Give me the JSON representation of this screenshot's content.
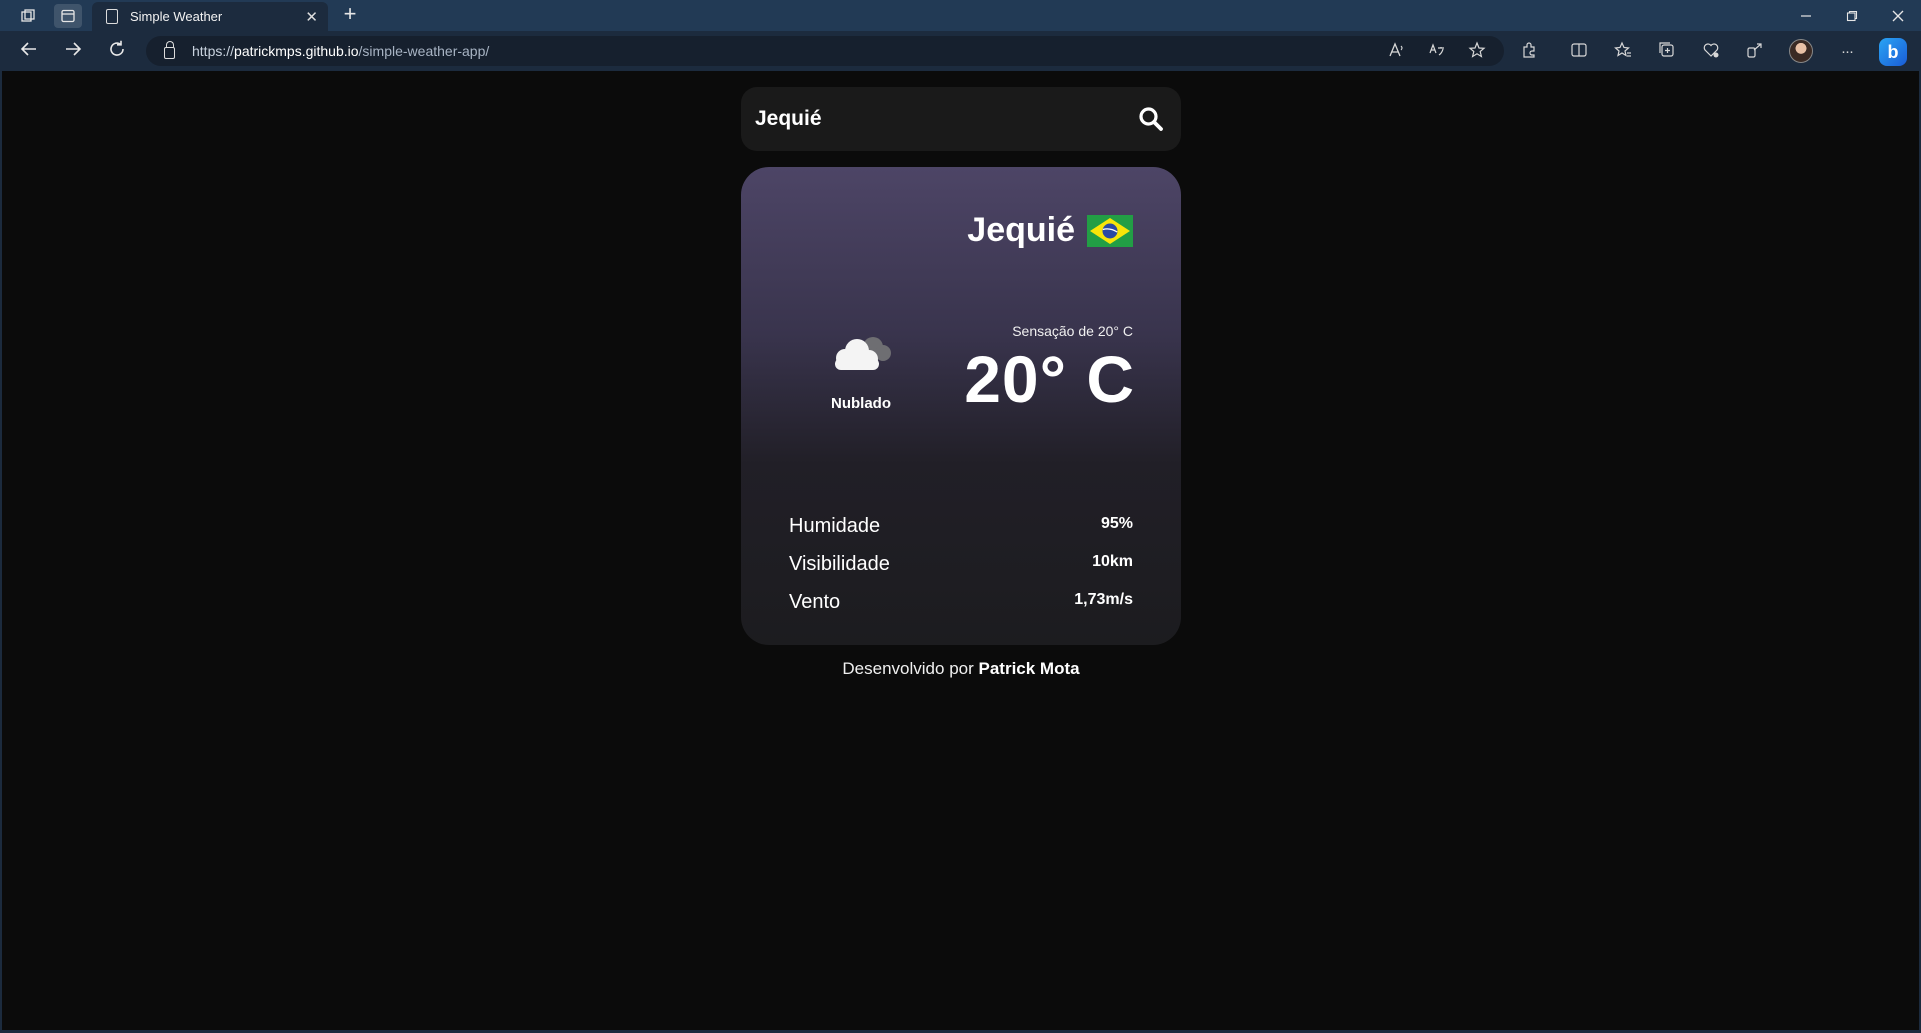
{
  "browser": {
    "tab_title": "Simple Weather",
    "url_scheme": "https://",
    "url_host": "patrickmps.github.io",
    "url_path": "/simple-weather-app/",
    "new_tab_glyph": "+",
    "close_tab_glyph": "✕",
    "more_glyph": "···"
  },
  "search": {
    "value": "Jequié",
    "icon": "search-icon"
  },
  "weather": {
    "city": "Jequié",
    "country_flag": "brazil-flag",
    "condition_icon": "cloud-icon",
    "condition": "Nublado",
    "feels_like": "Sensação de 20° C",
    "temperature": "20° C"
  },
  "stats": [
    {
      "label": "Humidade",
      "value": "95%"
    },
    {
      "label": "Visibilidade",
      "value": "10km"
    },
    {
      "label": "Vento",
      "value": "1,73m/s"
    }
  ],
  "footer": {
    "prefix": "Desenvolvido por",
    "author": "Patrick Mota"
  },
  "colors": {
    "page_bg": "#0b0b0b",
    "card_top": "#4d4566",
    "card_bottom": "#1c1c1f",
    "chrome": "#223a55"
  }
}
